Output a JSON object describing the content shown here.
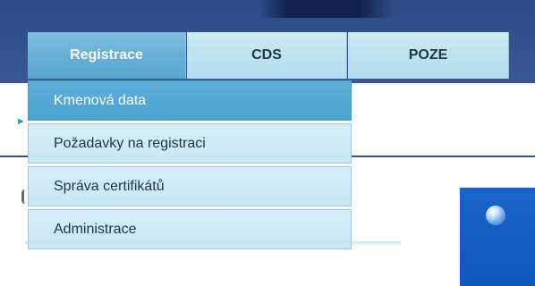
{
  "nav": {
    "tabs": [
      {
        "label": "Registrace",
        "active": true
      },
      {
        "label": "CDS",
        "active": false
      },
      {
        "label": "POZE",
        "active": false
      }
    ]
  },
  "dropdown": {
    "items": [
      {
        "label": "Kmenová data",
        "highlighted": true
      },
      {
        "label": "Požadavky na registraci",
        "highlighted": false
      },
      {
        "label": "Správa certifikátů",
        "highlighted": false
      },
      {
        "label": "Administrace",
        "highlighted": false
      }
    ]
  },
  "colors": {
    "header_blue": "#345290",
    "tab_light": "#bfe3f1",
    "tab_active": "#67b0d6",
    "panel_blue": "#1a63c8"
  },
  "icons": {
    "breadcrumb_arrow": "chevron-right-icon",
    "panel_orb": "orb-icon"
  }
}
